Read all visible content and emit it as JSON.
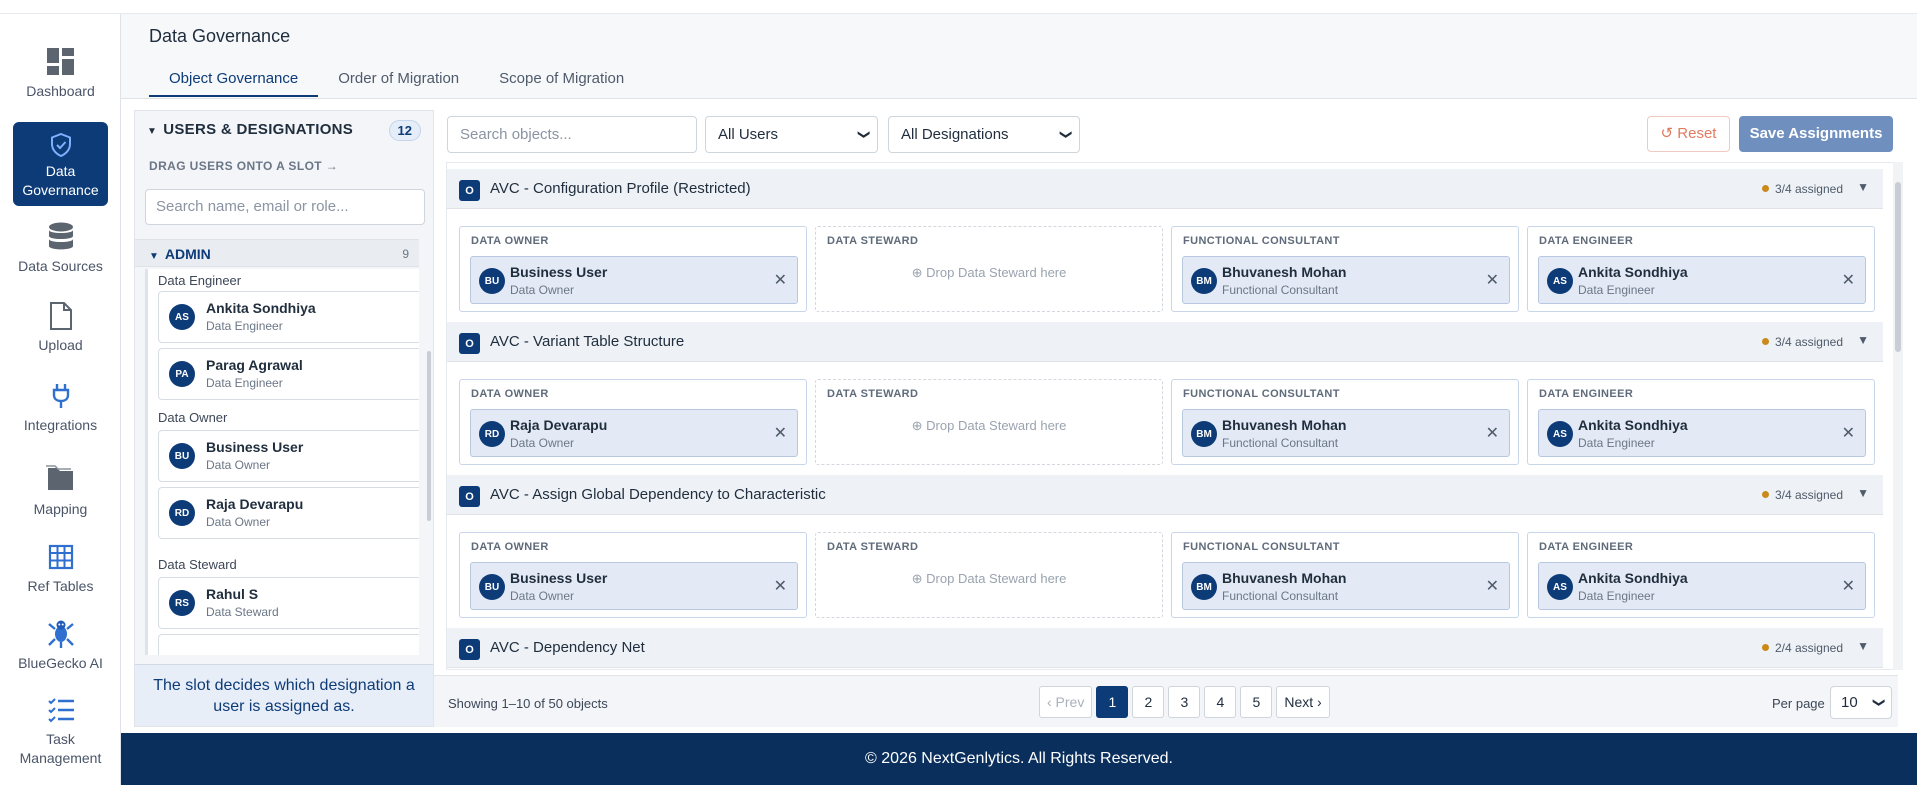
{
  "sidebar": {
    "items": [
      {
        "label": "Dashboard",
        "icon": "dashboard-icon"
      },
      {
        "label": "Data Governance",
        "icon": "shield-icon"
      },
      {
        "label": "Data Sources",
        "icon": "database-icon"
      },
      {
        "label": "Upload",
        "icon": "file-icon"
      },
      {
        "label": "Integrations",
        "icon": "plug-icon"
      },
      {
        "label": "Mapping",
        "icon": "folders-icon"
      },
      {
        "label": "Ref Tables",
        "icon": "table-icon"
      },
      {
        "label": "BlueGecko AI",
        "icon": "gecko-icon"
      },
      {
        "label": "Task Management",
        "icon": "tasks-icon"
      }
    ]
  },
  "header": {
    "title": "Data Governance",
    "tabs": [
      "Object Governance",
      "Order of Migration",
      "Scope of Migration"
    ]
  },
  "left_panel": {
    "title": "USERS & DESIGNATIONS",
    "count": "12",
    "drag_hint": "DRAG USERS ONTO A SLOT →",
    "search_placeholder": "Search name, email or role...",
    "group": {
      "name": "ADMIN",
      "count": "9"
    },
    "subgroups": [
      {
        "name": "Data Engineer",
        "users": [
          {
            "initials": "AS",
            "name": "Ankita Sondhiya",
            "role": "Data Engineer"
          },
          {
            "initials": "PA",
            "name": "Parag Agrawal",
            "role": "Data Engineer"
          }
        ]
      },
      {
        "name": "Data Owner",
        "users": [
          {
            "initials": "BU",
            "name": "Business User",
            "role": "Data Owner"
          },
          {
            "initials": "RD",
            "name": "Raja Devarapu",
            "role": "Data Owner"
          }
        ]
      },
      {
        "name": "Data Steward",
        "users": [
          {
            "initials": "RS",
            "name": "Rahul S",
            "role": "Data Steward"
          }
        ]
      }
    ],
    "tip": "The slot decides which designation a user is assigned as."
  },
  "toolbar": {
    "search_placeholder": "Search objects...",
    "users_filter": "All Users",
    "designations_filter": "All Designations",
    "reset_label": "Reset",
    "save_label": "Save Assignments"
  },
  "slot_labels": [
    "DATA OWNER",
    "DATA STEWARD",
    "FUNCTIONAL CONSULTANT",
    "DATA ENGINEER"
  ],
  "drop_text": "Drop Data Steward here",
  "objects": [
    {
      "name": "AVC - Configuration Profile (Restricted)",
      "status": "3/4 assigned",
      "owner": {
        "initials": "BU",
        "name": "Business User",
        "role": "Data Owner"
      },
      "consultant": {
        "initials": "BM",
        "name": "Bhuvanesh Mohan",
        "role": "Functional Consultant"
      },
      "engineer": {
        "initials": "AS",
        "name": "Ankita Sondhiya",
        "role": "Data Engineer"
      }
    },
    {
      "name": "AVC - Variant Table Structure",
      "status": "3/4 assigned",
      "owner": {
        "initials": "RD",
        "name": "Raja Devarapu",
        "role": "Data Owner"
      },
      "consultant": {
        "initials": "BM",
        "name": "Bhuvanesh Mohan",
        "role": "Functional Consultant"
      },
      "engineer": {
        "initials": "AS",
        "name": "Ankita Sondhiya",
        "role": "Data Engineer"
      }
    },
    {
      "name": "AVC - Assign Global Dependency to Characteristic",
      "status": "3/4 assigned",
      "owner": {
        "initials": "BU",
        "name": "Business User",
        "role": "Data Owner"
      },
      "consultant": {
        "initials": "BM",
        "name": "Bhuvanesh Mohan",
        "role": "Functional Consultant"
      },
      "engineer": {
        "initials": "AS",
        "name": "Ankita Sondhiya",
        "role": "Data Engineer"
      }
    },
    {
      "name": "AVC - Dependency Net",
      "status": "2/4 assigned"
    }
  ],
  "pagination": {
    "showing": "Showing 1–10 of 50 objects",
    "prev": "‹ Prev",
    "pages": [
      "1",
      "2",
      "3",
      "4",
      "5"
    ],
    "next": "Next ›",
    "per_page_label": "Per page",
    "per_page": "10"
  },
  "footer": "© 2026 NextGenlytics. All Rights Reserved."
}
